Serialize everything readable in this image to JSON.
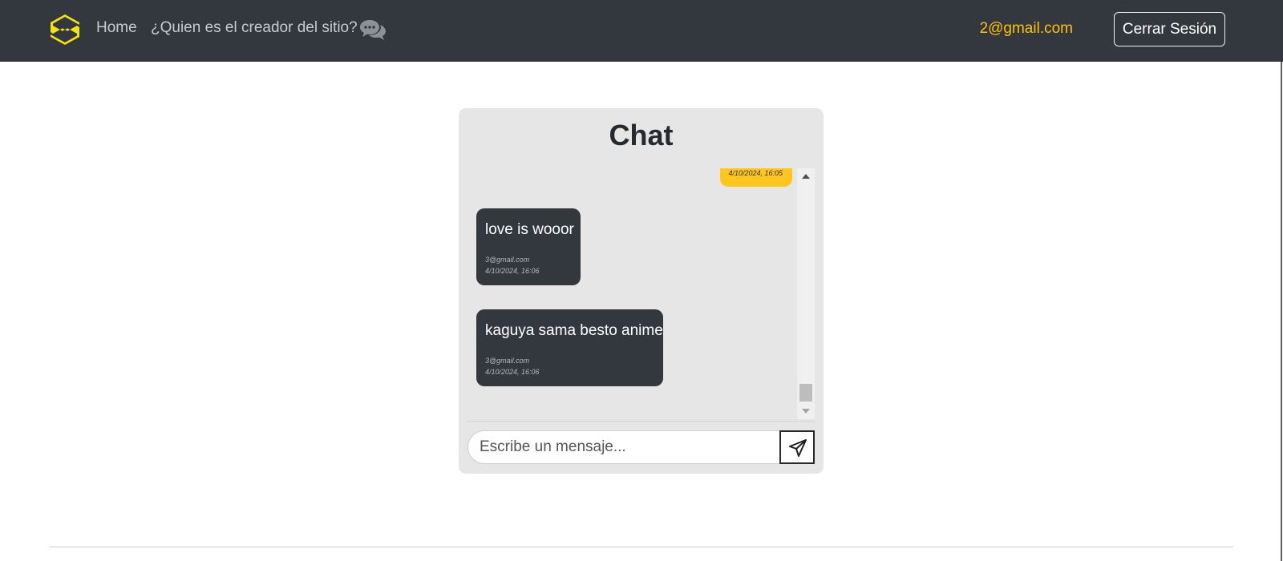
{
  "navbar": {
    "logo_icon": "s-logo-icon",
    "links": [
      {
        "label": "Home"
      },
      {
        "label": "¿Quien es el creador del sitio?"
      }
    ],
    "chat_icon": "chat-bubbles-icon",
    "user_email": "2@gmail.com",
    "logout_label": "Cerrar Sesión"
  },
  "chat": {
    "title": "Chat",
    "messages": [
      {
        "own": true,
        "time": "4/10/2024, 16:05"
      },
      {
        "own": false,
        "text": "love is wooor",
        "author": "3@gmail.com",
        "time": "4/10/2024, 16:06"
      },
      {
        "own": false,
        "text": "kaguya sama besto anime",
        "author": "3@gmail.com",
        "time": "4/10/2024, 16:06"
      }
    ],
    "input_placeholder": "Escribe un mensaje...",
    "send_icon": "send-paper-plane-icon"
  },
  "colors": {
    "navbar_bg": "#33373e",
    "accent": "#ffc107",
    "own_bubble": "#ffc71e",
    "other_bubble": "#33373e",
    "card_bg": "#e6e6e6"
  }
}
